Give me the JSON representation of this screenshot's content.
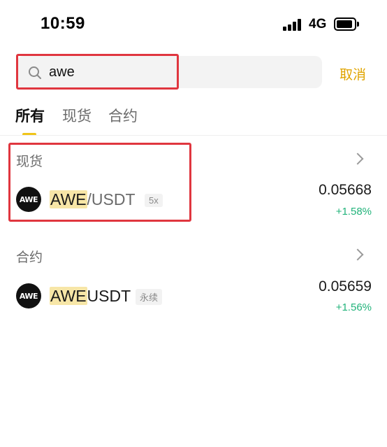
{
  "status_bar": {
    "time": "10:59",
    "network": "4G"
  },
  "search": {
    "value": "awe",
    "placeholder": "",
    "cancel_label": "取消"
  },
  "tabs": [
    {
      "label": "所有",
      "active": true
    },
    {
      "label": "现货",
      "active": false
    },
    {
      "label": "合约",
      "active": false
    }
  ],
  "sections": {
    "spot": {
      "title": "现货",
      "items": [
        {
          "base": "AWE",
          "quote": "/USDT",
          "tag": "5x",
          "price": "0.05668",
          "change": "+1.58%"
        }
      ]
    },
    "contract": {
      "title": "合约",
      "items": [
        {
          "base": "AWE",
          "quote": "USDT",
          "tag": "永续",
          "price": "0.05659",
          "change": "+1.56%"
        }
      ]
    }
  },
  "colors": {
    "accent": "#f0c419",
    "cancel": "#e0a400",
    "positive": "#21b37a",
    "highlight_box": "#e0363f",
    "match_highlight": "#f7e6a7"
  },
  "icons": {
    "search": "search-icon",
    "chevron": "chevron-right-icon",
    "coin_logo": "awe-logo-icon"
  },
  "logo_text": "AWE"
}
